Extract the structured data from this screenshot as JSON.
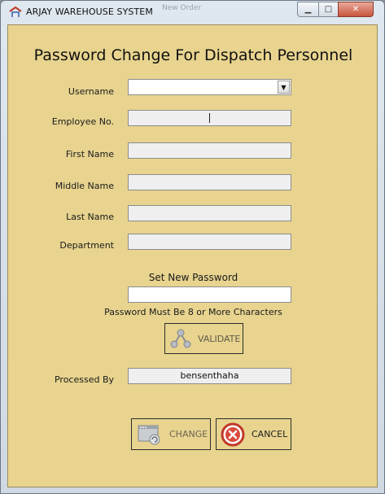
{
  "window": {
    "title": "ARJAY WAREHOUSE SYSTEM",
    "ghost_tab": "New Order",
    "min_symbol": "▁",
    "max_symbol": "□",
    "close_symbol": "✕"
  },
  "form": {
    "heading": "Password Change For Dispatch Personnel",
    "fields": {
      "username": {
        "label": "Username",
        "value": "",
        "dropdown_symbol": "▼"
      },
      "employee_no": {
        "label": "Employee No.",
        "value": ""
      },
      "first_name": {
        "label": "First Name",
        "value": ""
      },
      "middle_name": {
        "label": "Middle Name",
        "value": ""
      },
      "last_name": {
        "label": "Last Name",
        "value": ""
      },
      "department": {
        "label": "Department",
        "value": ""
      }
    },
    "new_password": {
      "title": "Set New Password",
      "value": "",
      "hint": "Password Must Be 8 or More Characters"
    },
    "validate_label": "VALIDATE",
    "processed_by": {
      "label": "Processed By",
      "value": "bensenthaha"
    },
    "change_label": "CHANGE",
    "cancel_label": "CANCEL"
  },
  "colors": {
    "panel": "#e8d48f",
    "cancel_icon": "#d84a3c"
  }
}
